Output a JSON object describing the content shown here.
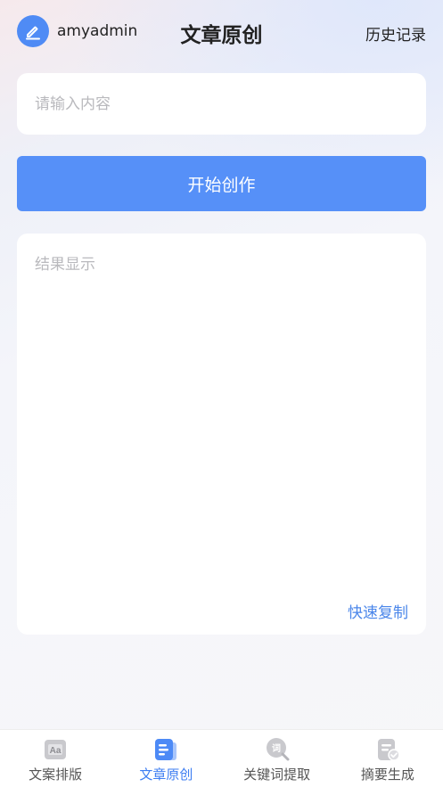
{
  "header": {
    "username": "amyadmin",
    "title": "文章原创",
    "history_label": "历史记录"
  },
  "input": {
    "placeholder": "请输入内容",
    "value": ""
  },
  "start_button_label": "开始创作",
  "result": {
    "placeholder": "结果显示",
    "copy_label": "快速复制"
  },
  "tabs": [
    {
      "label": "文案排版",
      "icon": "text-format-icon",
      "active": false
    },
    {
      "label": "文章原创",
      "icon": "document-icon",
      "active": true
    },
    {
      "label": "关键词提取",
      "icon": "keyword-search-icon",
      "active": false
    },
    {
      "label": "摘要生成",
      "icon": "summary-check-icon",
      "active": false
    }
  ],
  "colors": {
    "accent": "#5690f8",
    "active_tab": "#3d7ef2",
    "inactive_icon": "#c9c9cd",
    "placeholder": "#b9b9bd"
  }
}
